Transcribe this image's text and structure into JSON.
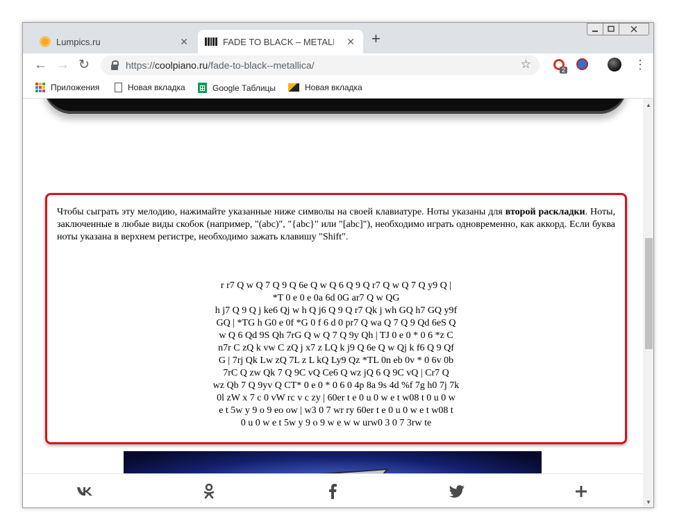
{
  "tabs": [
    {
      "label": "Lumpics.ru",
      "icon": "lumpics-favicon",
      "active": false
    },
    {
      "label": "FADE TO BLACK – METALLICA. Н",
      "icon": "piano-favicon",
      "active": true
    }
  ],
  "toolbar": {
    "url_scheme": "https://",
    "url_host": "coolpiano.ru",
    "url_path": "/fade-to-black--metallica/",
    "ext_badge": "2"
  },
  "bookmarks": [
    {
      "label": "Приложения",
      "icon": "apps-icon"
    },
    {
      "label": "Новая вкладка",
      "icon": "document-icon"
    },
    {
      "label": "Google Таблицы",
      "icon": "sheets-icon"
    },
    {
      "label": "Новая вкладка",
      "icon": "image-icon"
    }
  ],
  "content": {
    "intro_before": "Чтобы сыграть эту мелодию, нажимайте указанные ниже символы на своей клавиатуре. Ноты указаны для ",
    "intro_bold": "второй раскладки",
    "intro_after": ". Ноты, заключенные в любые виды скобок (например, \"(abc)\", \"{abc}\" или \"[abc]\"), необходимо играть одновременно, как аккорд. Если буква ноты указана в верхнем регистре, необходимо зажать клавишу \"Shift\".",
    "notes": [
      "r r7 Q w Q 7 Q 9 Q 6e Q w Q 6 Q 9 Q r7 Q w Q 7 Q y9 Q |",
      "*T 0 e 0 e 0a 6d 0G ar7 Q w QG",
      "h j7 Q 9 Q j ke6 Qj w h Q j6 Q 9 Q r7 Qk j wh GQ h7 GQ y9f",
      "GQ | *TG h G0 e 0f *G 0 f 6 d 0 pr7 Q wa Q 7 Q 9 Qd 6eS Q",
      "w Q 6 Qd 9S Qh 7rG Q w Q 7 Q 9y Qh | TJ 0 e 0 * 0 6 *z C",
      "n7r C zQ k vw C zQ j x7 z LQ k j9 Q 6e Q w Qj k f6 Q 9 Qf",
      "G | 7rj Qk Lw zQ 7L z L kQ Ly9 Qz *TL 0n eb 0v * 0 6v 0b",
      "7rC Q zw Qk 7 Q 9C vQ Ce6 Q wz jQ 6 Q 9C vQ | Cr7 Q",
      "wz Qb 7 Q 9yv Q CT* 0 e 0 * 0 6 0 4p 8a 9s 4d %f 7g h0 7j 7k",
      "0l zW x 7 c 0 vW rc v c zy | 60er t e 0 u 0 w e t w08 t 0 u 0 w",
      "e t 5w y 9 o 9 eo ow | w3 0 7 wr ry 60er t e 0 u 0 w e t w08 t",
      "0 u 0 w e t 5w y 9 o 9 w e w w urw0 3 0 7 3rw te"
    ]
  },
  "share": [
    {
      "name": "vk",
      "icon": "vk-icon"
    },
    {
      "name": "odnoklassniki",
      "icon": "odnoklassniki-icon"
    },
    {
      "name": "facebook",
      "icon": "facebook-icon"
    },
    {
      "name": "twitter",
      "icon": "twitter-icon"
    },
    {
      "name": "more",
      "icon": "plus-icon"
    }
  ],
  "colors": {
    "highlight_border": "#d0171e",
    "share_icon": "#4a4a4a"
  }
}
